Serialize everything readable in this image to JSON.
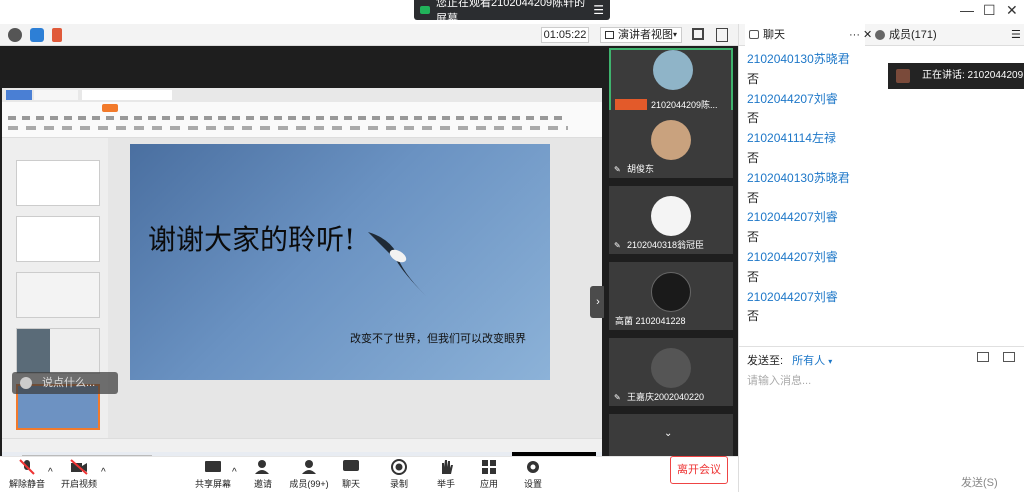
{
  "app": {
    "share_banner": "您正在观看2102044209陈轩的屏幕",
    "timer": "01:05:22",
    "view_mode": "演讲者视图"
  },
  "presentation": {
    "slide_title": "谢谢大家的聆听!",
    "slide_subtitle": "改变不了世界，但我们可以改变眼界"
  },
  "overlay": {
    "chat_placeholder": "说点什么..."
  },
  "participants": [
    {
      "name": "2102044209陈..."
    },
    {
      "name": "胡俊东"
    },
    {
      "name": "2102040318翁冠臣"
    },
    {
      "name": "高菌 2102041228"
    },
    {
      "name": "王嘉庆2002040220"
    }
  ],
  "toolbar": {
    "mute": "解除静音",
    "video": "开启视频",
    "share": "共享屏幕",
    "invite": "邀请",
    "members": "成员(99+)",
    "chat": "聊天",
    "record": "录制",
    "raise": "举手",
    "apps": "应用",
    "settings": "设置",
    "leave": "离开会议"
  },
  "panel": {
    "chat_tab": "聊天",
    "members_tab": "成员(171)",
    "speaking": "正在讲话: 2102044209陈",
    "send_to_label": "发送至:",
    "send_to_value": "所有人",
    "input_placeholder": "请输入消息...",
    "send_button": "发送(S)"
  },
  "messages": [
    {
      "name": "2102040130苏晓君",
      "text": "否"
    },
    {
      "name": "2102044207刘睿",
      "text": "否"
    },
    {
      "name": "2102041114左禄",
      "text": "否"
    },
    {
      "name": "2102040130苏晓君",
      "text": "否"
    },
    {
      "name": "2102044207刘睿",
      "text": "否"
    },
    {
      "name": "2102044207刘睿",
      "text": "否"
    },
    {
      "name": "2102044207刘睿",
      "text": "否"
    }
  ],
  "colors": {
    "accent": "#1d77c8",
    "leave": "#e33333",
    "active_tile": "#3fb36e"
  }
}
